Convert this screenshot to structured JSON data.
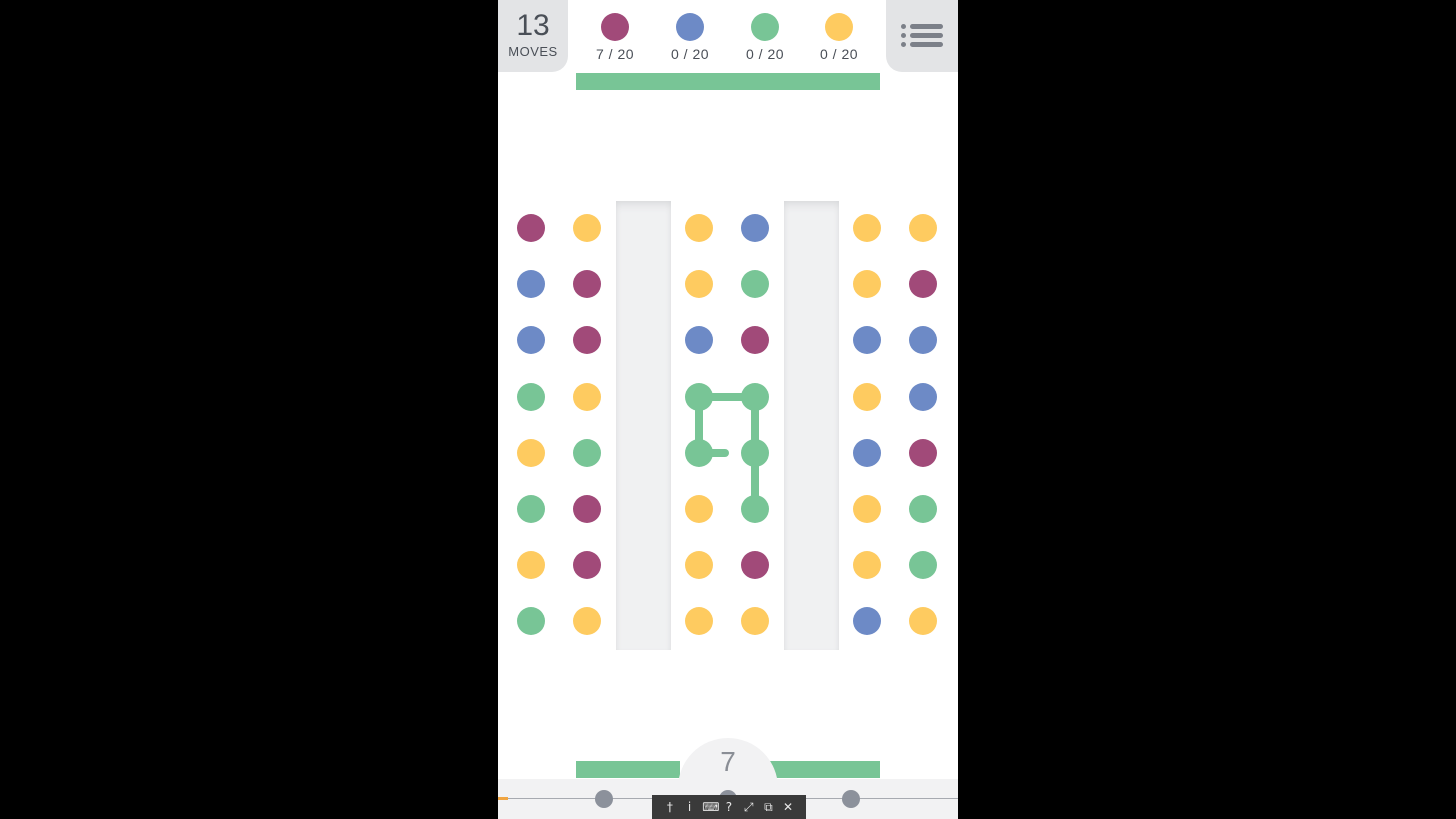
{
  "header": {
    "moves_count": "13",
    "moves_label": "MOVES",
    "menu_icon": "menu-list-icon"
  },
  "goals": [
    {
      "color_name": "purple",
      "color": "#a14a79",
      "text": "7 / 20",
      "collected": 7,
      "target": 20
    },
    {
      "color_name": "blue",
      "color": "#6d8ac6",
      "text": "0 / 20",
      "collected": 0,
      "target": 20
    },
    {
      "color_name": "green",
      "color": "#78c596",
      "text": "0 / 20",
      "collected": 0,
      "target": 20
    },
    {
      "color_name": "yellow",
      "color": "#fecb60",
      "text": "0 / 20",
      "collected": 0,
      "target": 20
    }
  ],
  "colors": {
    "P": "#a14a79",
    "B": "#6d8ac6",
    "G": "#78c596",
    "Y": "#fecb60",
    "line": "#78c596"
  },
  "board": {
    "rows": [
      [
        "P",
        "Y",
        "Y",
        "B",
        "Y",
        "Y"
      ],
      [
        "B",
        "P",
        "Y",
        "G",
        "Y",
        "P"
      ],
      [
        "B",
        "P",
        "B",
        "P",
        "B",
        "B"
      ],
      [
        "G",
        "Y",
        "G",
        "G",
        "Y",
        "B"
      ],
      [
        "Y",
        "G",
        "G",
        "G",
        "B",
        "P"
      ],
      [
        "G",
        "P",
        "Y",
        "G",
        "Y",
        "G"
      ],
      [
        "Y",
        "P",
        "Y",
        "P",
        "Y",
        "G"
      ],
      [
        "G",
        "Y",
        "Y",
        "Y",
        "B",
        "Y"
      ]
    ],
    "wall_count": 2,
    "selected_path": [
      [
        4,
        2
      ],
      [
        3,
        2
      ],
      [
        3,
        3
      ],
      [
        4,
        3
      ],
      [
        5,
        3
      ]
    ]
  },
  "footer": {
    "level_number": "7",
    "tools": [
      "pin-icon",
      "info-icon",
      "keyboard-icon",
      "help-icon",
      "shrink-icon",
      "window-icon",
      "close-icon"
    ],
    "tool_glyphs": [
      "†",
      "i",
      "⌨",
      "?",
      "⤢",
      "⧉",
      "✕"
    ]
  }
}
